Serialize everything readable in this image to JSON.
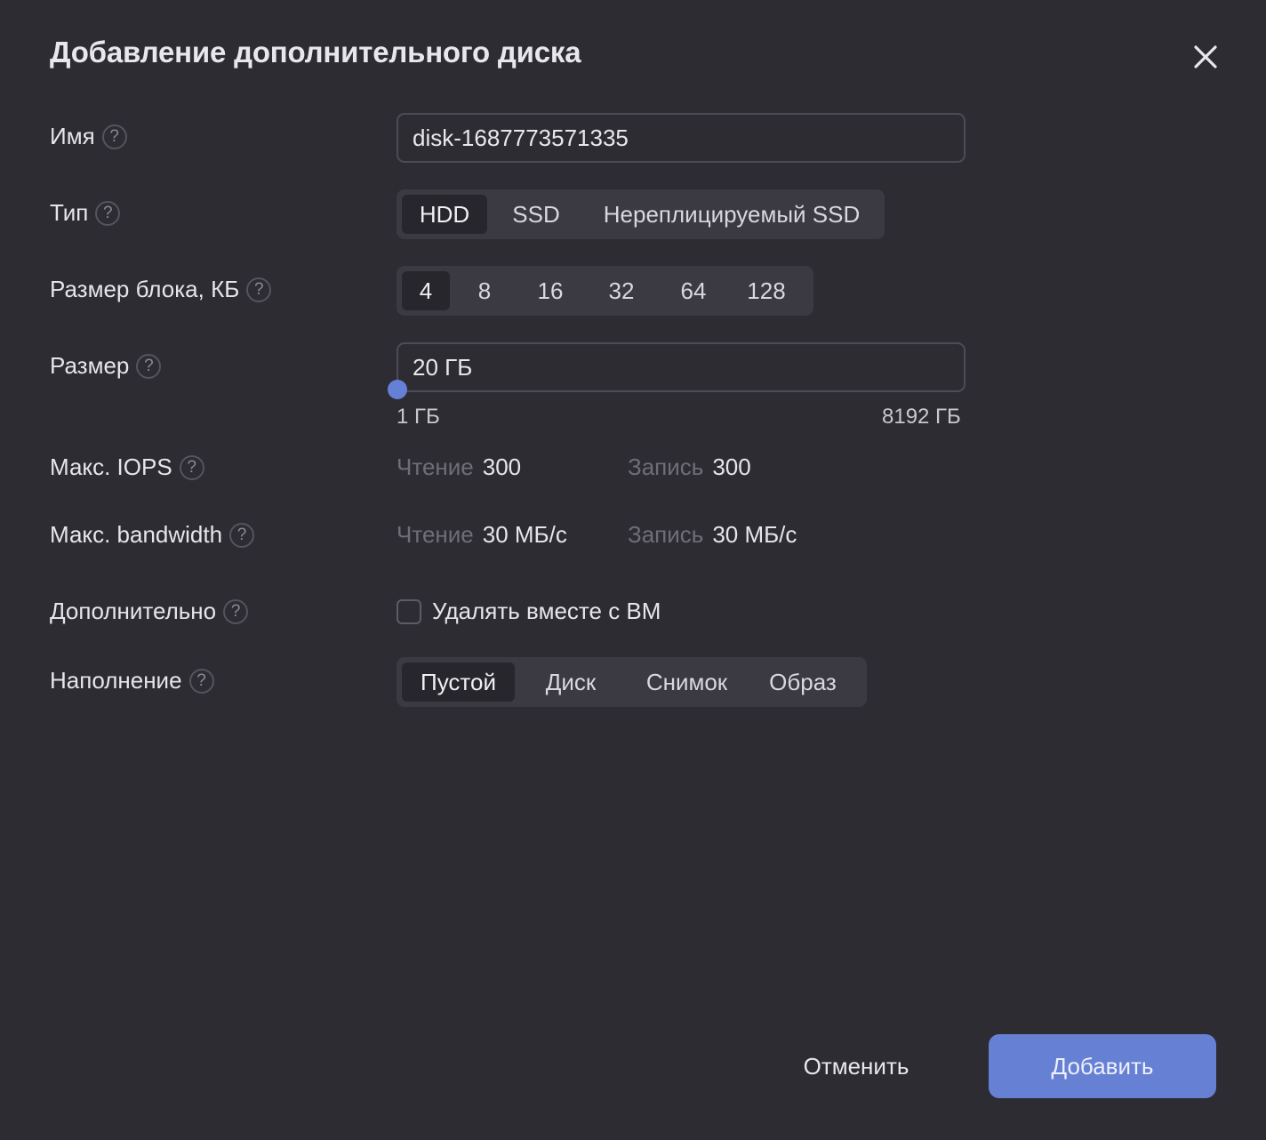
{
  "dialog": {
    "title": "Добавление дополнительного диска",
    "close_icon": "close-icon"
  },
  "help_symbol": "?",
  "fields": {
    "name": {
      "label": "Имя",
      "value": "disk-1687773571335"
    },
    "type": {
      "label": "Тип",
      "options": [
        "HDD",
        "SSD",
        "Нереплицируемый SSD"
      ],
      "selected": "HDD"
    },
    "block_size": {
      "label": "Размер блока, КБ",
      "options": [
        "4",
        "8",
        "16",
        "32",
        "64",
        "128"
      ],
      "selected": "4"
    },
    "size": {
      "label": "Размер",
      "value": "20 ГБ",
      "min_label": "1 ГБ",
      "max_label": "8192 ГБ",
      "slider_fraction": 0.0023
    },
    "iops": {
      "label": "Макс. IOPS",
      "read_label": "Чтение",
      "read_value": "300",
      "write_label": "Запись",
      "write_value": "300"
    },
    "bandwidth": {
      "label": "Макс. bandwidth",
      "read_label": "Чтение",
      "read_value": "30 МБ/с",
      "write_label": "Запись",
      "write_value": "30 МБ/с"
    },
    "additional": {
      "label": "Дополнительно",
      "checkbox_label": "Удалять вместе с ВМ",
      "checked": false
    },
    "fill": {
      "label": "Наполнение",
      "options": [
        "Пустой",
        "Диск",
        "Снимок",
        "Образ"
      ],
      "selected": "Пустой"
    }
  },
  "footer": {
    "cancel_label": "Отменить",
    "add_label": "Добавить"
  },
  "colors": {
    "background": "#2d2c33",
    "accent": "#6680d4",
    "segment_bg": "#3b3a42",
    "segment_selected": "#27262c"
  }
}
